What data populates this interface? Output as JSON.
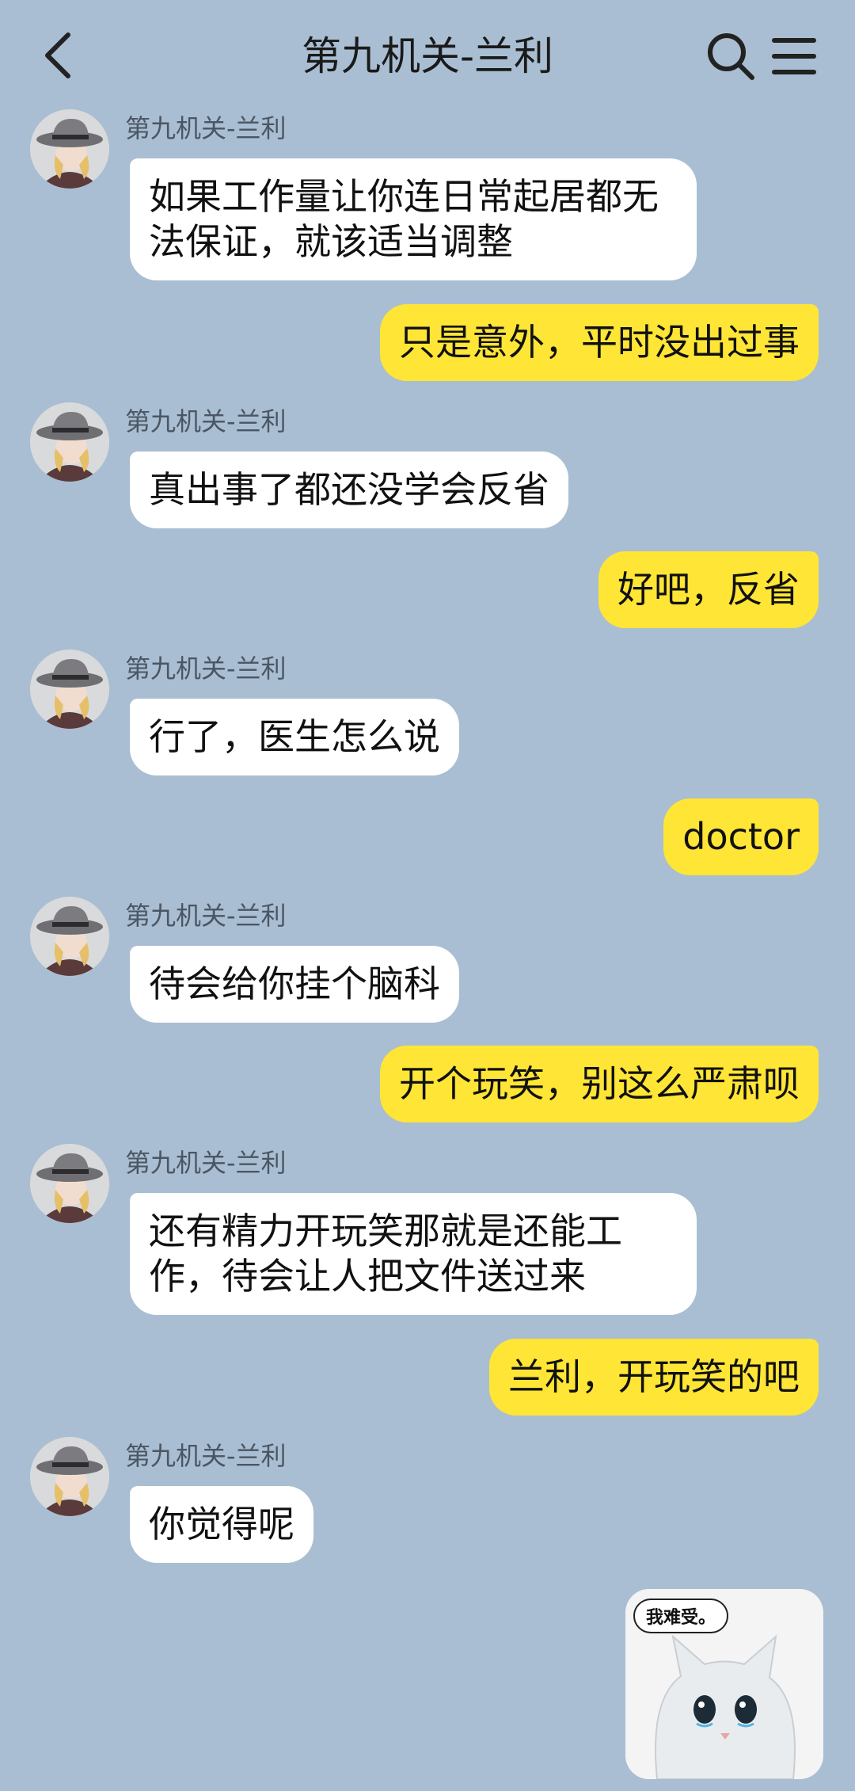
{
  "header": {
    "title": "第九机关-兰利",
    "back_icon": "chevron-left-icon",
    "search_icon": "search-icon",
    "menu_icon": "hamburger-menu-icon"
  },
  "colors": {
    "background": "#A9BED2",
    "incoming_bubble": "#FFFFFF",
    "outgoing_bubble": "#FFE535"
  },
  "messages": [
    {
      "sender": "第九机关-兰利",
      "text": "如果工作量让你连日常起居都无法保证，就该适当调整",
      "direction": "incoming"
    },
    {
      "text": "只是意外，平时没出过事",
      "direction": "outgoing"
    },
    {
      "sender": "第九机关-兰利",
      "text": "真出事了都还没学会反省",
      "direction": "incoming"
    },
    {
      "text": "好吧，反省",
      "direction": "outgoing"
    },
    {
      "sender": "第九机关-兰利",
      "text": "行了，医生怎么说",
      "direction": "incoming"
    },
    {
      "text": "doctor",
      "direction": "outgoing"
    },
    {
      "sender": "第九机关-兰利",
      "text": "待会给你挂个脑科",
      "direction": "incoming"
    },
    {
      "text": "开个玩笑，别这么严肃呗",
      "direction": "outgoing"
    },
    {
      "sender": "第九机关-兰利",
      "text": "还有精力开玩笑那就是还能工作，待会让人把文件送过来",
      "direction": "incoming"
    },
    {
      "text": "兰利，开玩笑的吧",
      "direction": "outgoing"
    },
    {
      "sender": "第九机关-兰利",
      "text": "你觉得呢",
      "direction": "incoming"
    }
  ],
  "sticker": {
    "caption": "我难受。",
    "icon": "crying-cat-sticker"
  }
}
